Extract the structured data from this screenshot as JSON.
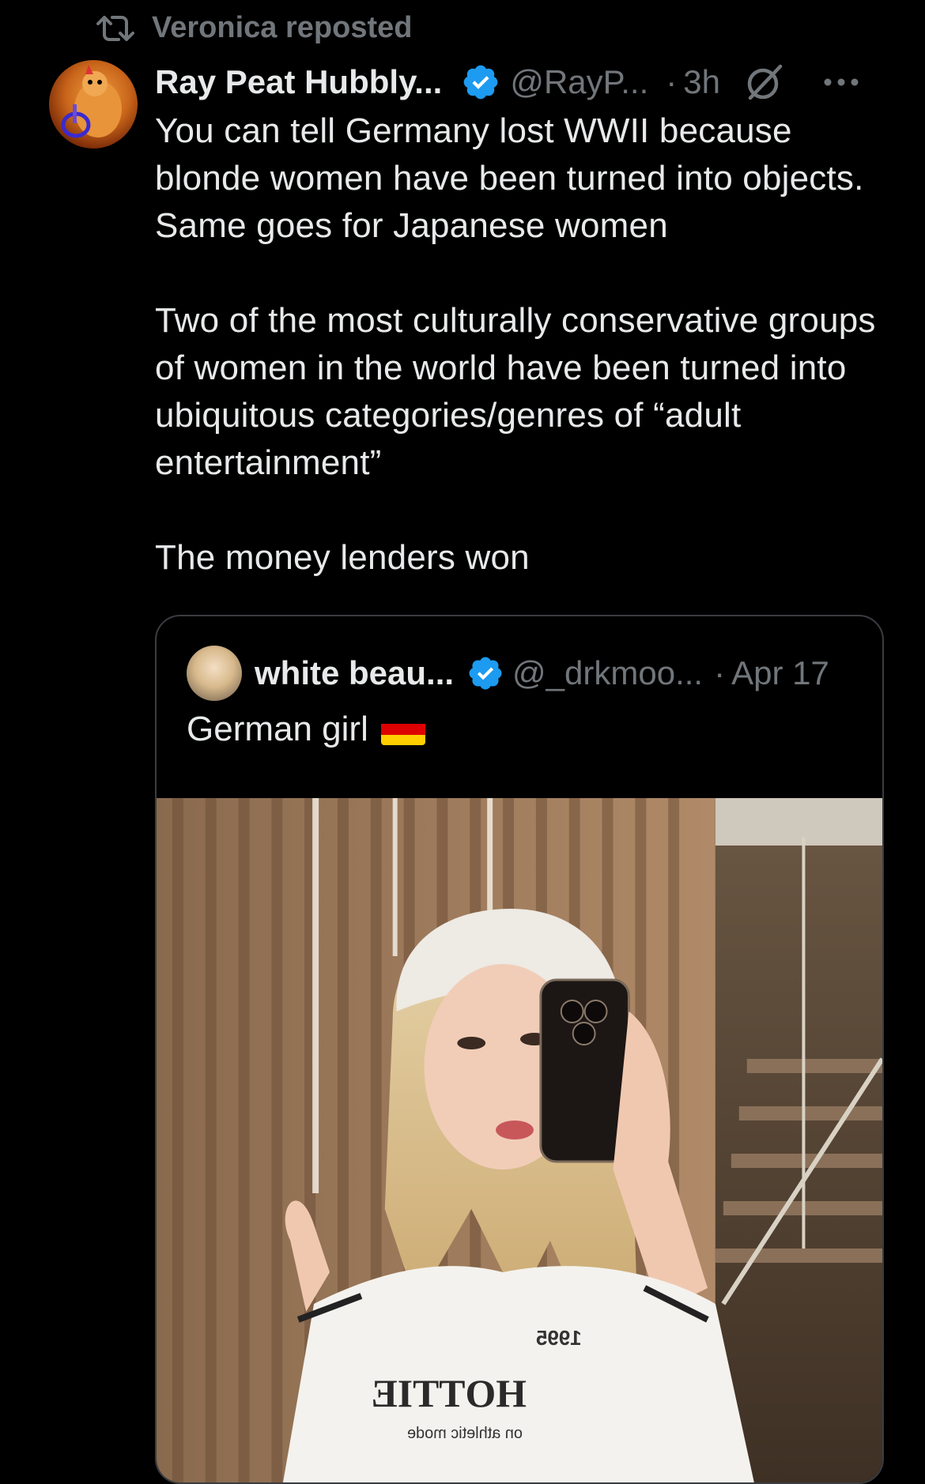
{
  "social_context": {
    "text": "Veronica reposted"
  },
  "tweet": {
    "author_name": "Ray Peat Hubbly...",
    "handle": "@RayP...",
    "separator": "·",
    "time": "3h",
    "text": "You can tell Germany lost WWII because blonde women have been turned into objects. Same goes for Japanese women\n\nTwo of the most culturally conservative groups of women in the world have been turned into ubiquitous categories/genres of “adult entertainment”\n\nThe money lenders won"
  },
  "quoted_tweet": {
    "author_name": "white beau...",
    "handle": "@_drkmoo...",
    "separator": "·",
    "date": "Apr 17",
    "text": "German girl",
    "shirt_text_top": "1995",
    "shirt_text_main": "HOTTIE",
    "shirt_text_bottom": "on athletic mode"
  },
  "colors": {
    "background": "#000000",
    "text_primary": "#e7e9ea",
    "text_secondary": "#71767b",
    "verified_blue": "#1d9bf0",
    "border": "#3a3d41"
  },
  "icons": {
    "repost": "repost-icon",
    "verified": "verified-badge-icon",
    "grok": "grok-icon",
    "more": "more-options-icon",
    "flag": "germany-flag-icon"
  }
}
